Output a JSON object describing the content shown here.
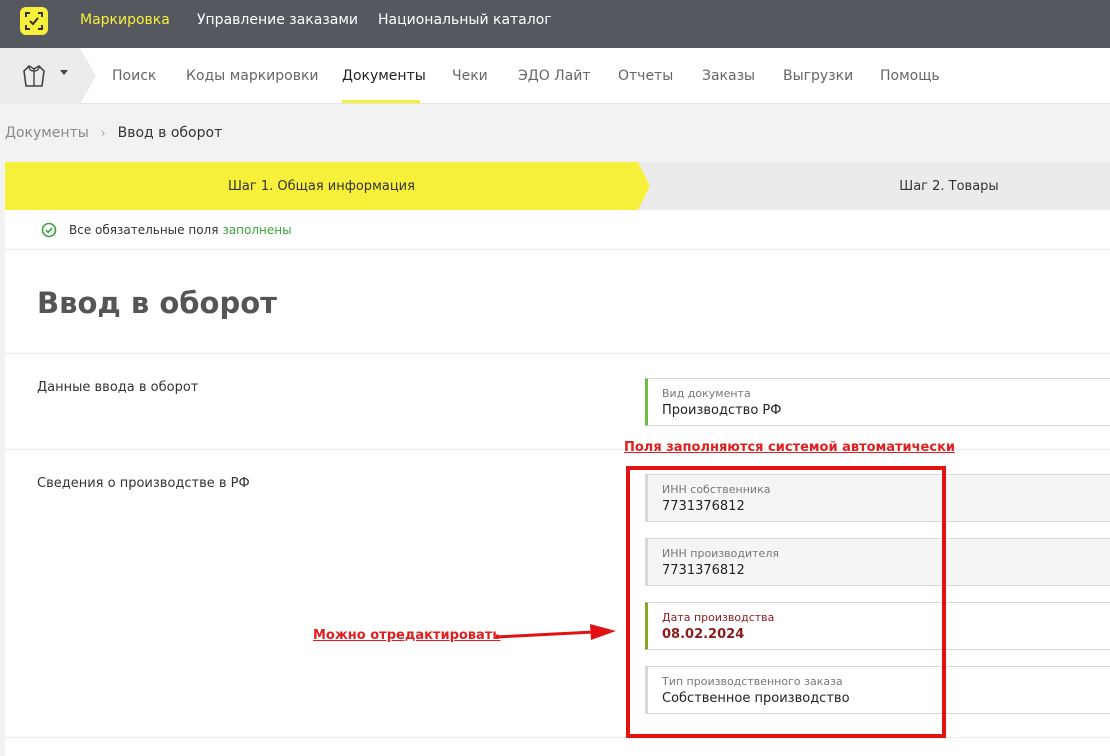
{
  "topbar": {
    "items": [
      "Маркировка",
      "Управление заказами",
      "Национальный каталог"
    ],
    "active_index": 0
  },
  "subnav": {
    "org_icon": "jacket-icon",
    "items": [
      "Поиск",
      "Коды маркировки",
      "Документы",
      "Чеки",
      "ЭДО Лайт",
      "Отчеты",
      "Заказы",
      "Выгрузки",
      "Помощь"
    ],
    "active_index": 2
  },
  "breadcrumb": {
    "parent": "Документы",
    "separator": "›",
    "current": "Ввод в оборот"
  },
  "steps": {
    "step1": "Шаг 1. Общая информация",
    "step2": "Шаг 2. Товары"
  },
  "status": {
    "text": "Все обязательные поля",
    "ok_text": "заполнены"
  },
  "page": {
    "title": "Ввод в оборот"
  },
  "sections": {
    "entry_data": {
      "label": "Данные ввода в оборот",
      "doc_type_label": "Вид документа",
      "doc_type_value": "Производство РФ"
    },
    "production": {
      "label": "Сведения о производстве в РФ",
      "owner_inn_label": "ИНН собственника",
      "owner_inn_value": "7731376812",
      "producer_inn_label": "ИНН производителя",
      "producer_inn_value": "7731376812",
      "prod_date_label": "Дата производства",
      "prod_date_value": "08.02.2024",
      "order_type_label": "Тип производственного заказа",
      "order_type_value": "Собственное производство"
    }
  },
  "annotations": {
    "auto_filled": "Поля заполняются системой автоматически",
    "editable": "Можно отредактировать"
  },
  "colors": {
    "accent_yellow": "#f6f03a",
    "topbar": "#55595f",
    "annotation_red": "#e21e1e",
    "ok_green": "#3aa33a"
  }
}
